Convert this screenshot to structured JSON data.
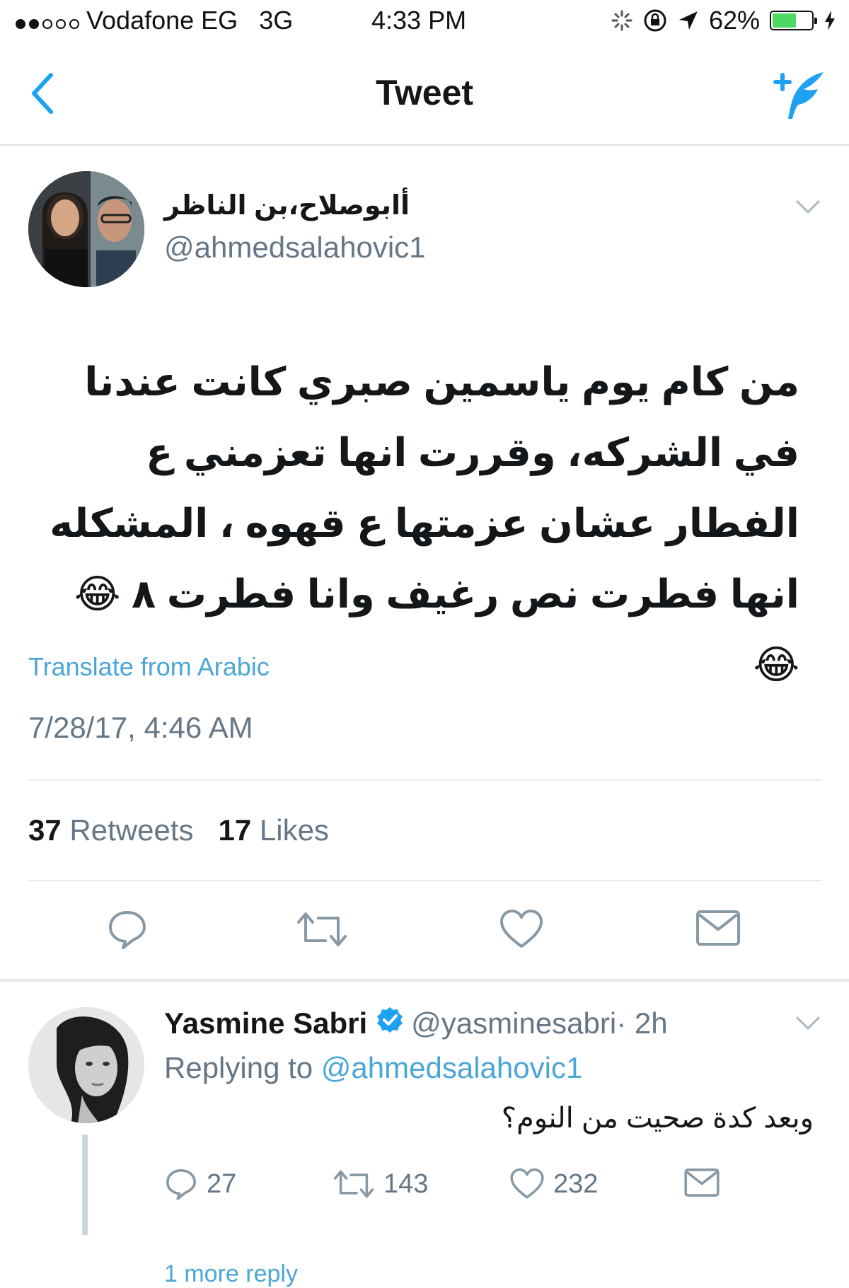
{
  "status_bar": {
    "carrier": "Vodafone EG",
    "network": "3G",
    "time": "4:33 PM",
    "battery": "62%",
    "battery_level": 0.62
  },
  "nav": {
    "title": "Tweet",
    "back_icon": "chevron-left-icon",
    "compose_icon": "compose-tweet-icon"
  },
  "tweet": {
    "display_name": "أابوصلاح،بن الناظر",
    "handle": "@ahmedsalahovic1",
    "text": "من كام يوم ياسمين صبري كانت عندنا في الشركه، وقررت انها تعزمني ع الفطار عشان عزمتها ع قهوه ، المشكله انها فطرت نص رغيف وانا فطرت ٨ 😂😂",
    "translate": "Translate from Arabic",
    "timestamp": "7/28/17, 4:46 AM",
    "retweets_count": "37",
    "retweets_label": "Retweets",
    "likes_count": "17",
    "likes_label": "Likes"
  },
  "reply": {
    "name": "Yasmine Sabri",
    "handle": "@yasminesabri",
    "time": " · 2h",
    "replying_prefix": "Replying to",
    "replying_to": "@ahmedsalahovic1",
    "text": "وبعد كدة صحيت من النوم؟",
    "reply_count": "27",
    "retweet_count": "143",
    "like_count": "232",
    "more_replies": "1 more reply"
  },
  "colors": {
    "accent": "#1da1f2",
    "link": "#4aa6d6",
    "muted": "#657786",
    "battery": "#4cd964"
  }
}
